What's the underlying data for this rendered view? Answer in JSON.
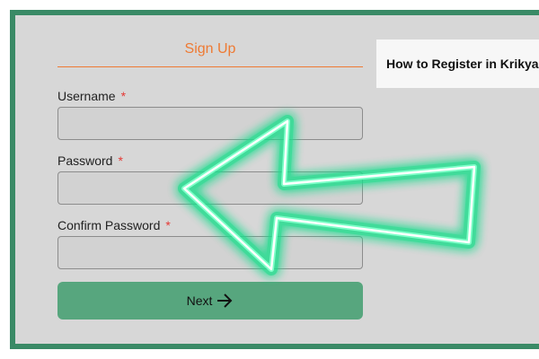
{
  "signup": {
    "title": "Sign Up",
    "accent_color": "#ee7a33"
  },
  "fields": {
    "username": {
      "label": "Username",
      "required_mark": "*",
      "value": ""
    },
    "password": {
      "label": "Password",
      "required_mark": "*",
      "value": ""
    },
    "confirm_password": {
      "label": "Confirm Password",
      "required_mark": "*",
      "value": ""
    }
  },
  "next_button": {
    "label": "Next",
    "icon": "arrow-right-icon",
    "color": "#57a67e"
  },
  "guide": {
    "title": "How to Register in Krikya"
  },
  "overlay": {
    "icon": "neon-arrow-left-icon",
    "color": "#2ee89a"
  },
  "frame_color": "#3a8a66"
}
